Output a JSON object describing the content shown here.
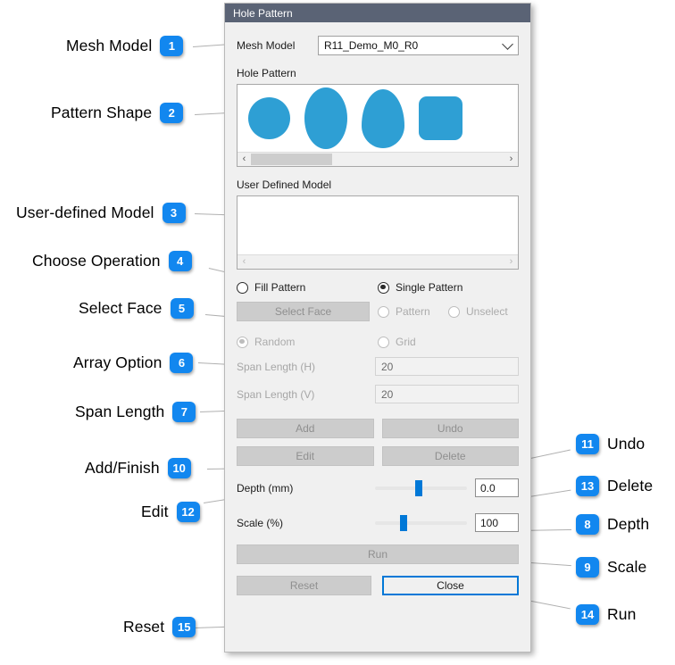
{
  "dialog": {
    "title": "Hole Pattern",
    "mesh_model": {
      "label": "Mesh Model",
      "value": "R11_Demo_M0_R0",
      "chevron": "chevron-down-icon"
    },
    "hole_pattern": {
      "label": "Hole Pattern",
      "shapes": [
        {
          "name": "circle"
        },
        {
          "name": "ellipse"
        },
        {
          "name": "egg"
        },
        {
          "name": "rounded-square"
        }
      ],
      "shape_color": "#2e9fd4",
      "scroll_left_arrow": "‹",
      "scroll_right_arrow": "›"
    },
    "user_defined_model": {
      "label": "User Defined Model",
      "value": "",
      "scroll_left_arrow": "‹",
      "scroll_right_arrow": "›"
    },
    "operation": {
      "fill_pattern": "Fill Pattern",
      "single_pattern": "Single Pattern"
    },
    "select_face": {
      "button": "Select Face",
      "pattern": "Pattern",
      "unselect": "Unselect"
    },
    "array_option": {
      "random": "Random",
      "grid": "Grid"
    },
    "span": {
      "h_label": "Span Length (H)",
      "h_value": "20",
      "v_label": "Span Length (V)",
      "v_value": "20"
    },
    "actions": {
      "add": "Add",
      "undo": "Undo",
      "edit": "Edit",
      "delete": "Delete",
      "run": "Run",
      "reset": "Reset",
      "close": "Close"
    },
    "depth": {
      "label": "Depth (mm)",
      "value": "0.0",
      "handle_pct": 48
    },
    "scale": {
      "label": "Scale (%)",
      "value": "100",
      "handle_pct": 31
    }
  },
  "annotations": {
    "accent_color": "#1287ef",
    "left": [
      {
        "num": "1",
        "label": "Mesh Model"
      },
      {
        "num": "2",
        "label": "Pattern Shape"
      },
      {
        "num": "3",
        "label": "User-defined Model"
      },
      {
        "num": "4",
        "label": "Choose Operation"
      },
      {
        "num": "5",
        "label": "Select Face"
      },
      {
        "num": "6",
        "label": "Array Option"
      },
      {
        "num": "7",
        "label": "Span Length"
      },
      {
        "num": "10",
        "label": "Add/Finish"
      },
      {
        "num": "12",
        "label": "Edit"
      },
      {
        "num": "15",
        "label": "Reset"
      }
    ],
    "right": [
      {
        "num": "11",
        "label": "Undo"
      },
      {
        "num": "13",
        "label": "Delete"
      },
      {
        "num": "8",
        "label": "Depth"
      },
      {
        "num": "9",
        "label": "Scale"
      },
      {
        "num": "14",
        "label": "Run"
      }
    ]
  }
}
